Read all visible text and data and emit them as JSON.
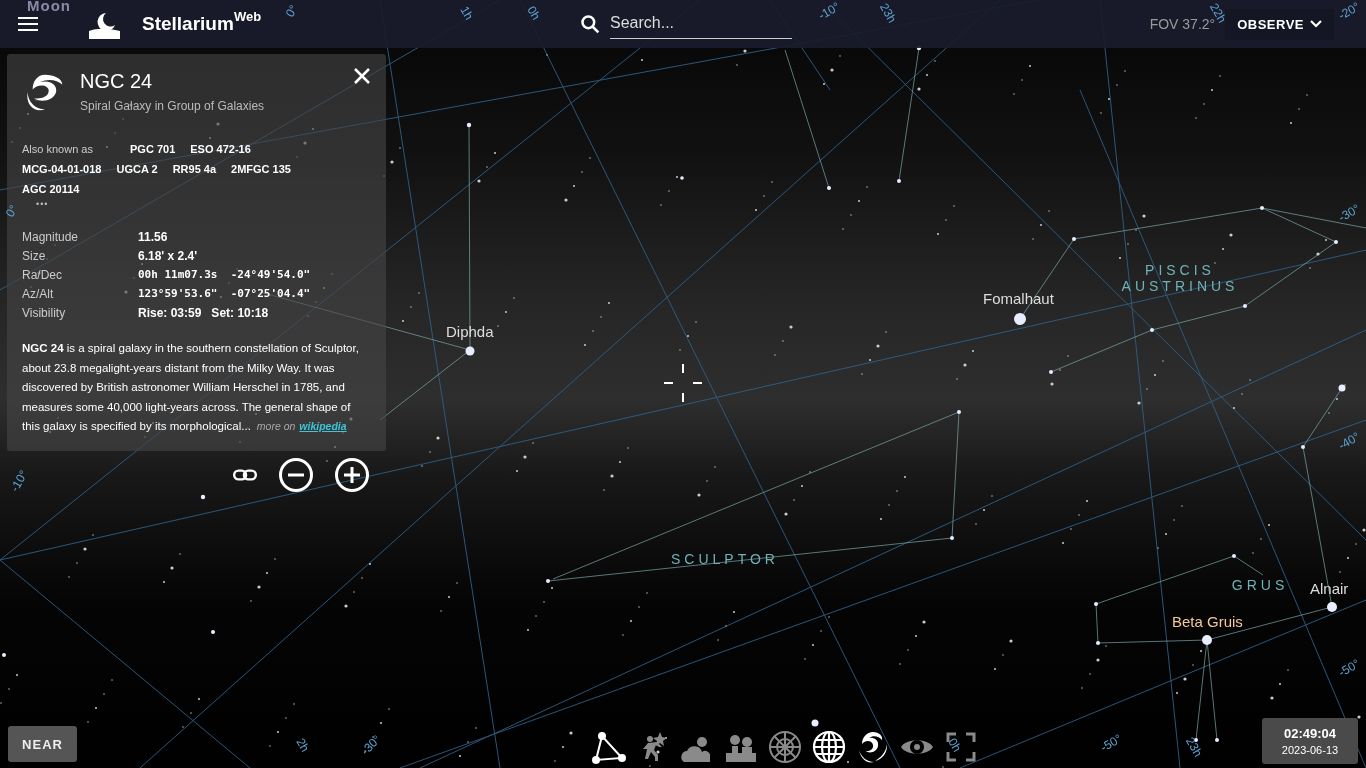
{
  "top_bar": {
    "title": "Stellarium",
    "title_sup": "Web",
    "search": {
      "placeholder": "Search..."
    },
    "fov": "FOV 37.2°",
    "observe": "OBSERVE"
  },
  "sky": {
    "objects": [
      {
        "name": "Moon",
        "color": "#8a8aa8"
      },
      {
        "name": "Diphda",
        "color": "#dddddd"
      },
      {
        "name": "Fomalhaut",
        "color": "#dddddd"
      },
      {
        "name": "Beta Gruis",
        "color": "#f3c99a"
      },
      {
        "name": "Alnair",
        "color": "#dddddd"
      }
    ],
    "constellations": [
      {
        "name": "PISCIS AUSTRINUS"
      },
      {
        "name": "SCULPTOR"
      },
      {
        "name": "GRUS"
      }
    ],
    "grid_labels": [
      "0°",
      "1h",
      "0h",
      "-10°",
      "23h",
      "22h",
      "-20°",
      "-30°",
      "-40°",
      "-50°",
      "0°",
      "-10°",
      "2h",
      "-30°",
      "0h",
      "-50°",
      "23h"
    ]
  },
  "info_panel": {
    "title": "NGC 24",
    "subtitle": "Spiral Galaxy in Group of Galaxies",
    "aka_label": "Also known as",
    "aka": [
      "PGC 701",
      "ESO 472-16",
      "MCG-04-01-018",
      "UGCA 2",
      "RR95 4a",
      "2MFGC 135",
      "AGC 20114"
    ],
    "aka_more": "•••",
    "rows": [
      {
        "label": "Magnitude",
        "value": "11.56",
        "kind": "plain"
      },
      {
        "label": "Size",
        "value": "6.18' x 2.4'",
        "kind": "plain"
      },
      {
        "label": "Ra/Dec",
        "value": "00h 11m07.3s  -24°49'54.0\"",
        "kind": "mono"
      },
      {
        "label": "Az/Alt",
        "value": "123°59'53.6\"  -07°25'04.4\"",
        "kind": "mono"
      },
      {
        "label": "Visibility",
        "value": "Rise: 03:59   Set: 10:18",
        "kind": "plain"
      }
    ],
    "description": "**NGC 24** is a spiral galaxy in the southern constellation of Sculptor, about 23.8 megalight-years distant from the Milky Way. It was discovered by British astronomer William Herschel in 1785, and measures some 40,000 light-years across. The general shape of this galaxy is specified by its morphological...",
    "more_on": "more on",
    "link": "wikipedia"
  },
  "view_buttons": [
    {
      "kind": "constellation-lines",
      "on": true
    },
    {
      "kind": "constellation-art",
      "on": false
    },
    {
      "kind": "atmosphere",
      "on": false
    },
    {
      "kind": "landscape",
      "on": false
    },
    {
      "kind": "azimuthal-grid",
      "on": false
    },
    {
      "kind": "equatorial-grid",
      "on": true
    },
    {
      "kind": "deep-sky",
      "on": true
    },
    {
      "kind": "night-mode",
      "on": false
    },
    {
      "kind": "fullscreen",
      "on": false
    }
  ],
  "near_button": "NEAR",
  "clock": {
    "time": "02:49:04",
    "date": "2023-06-13"
  }
}
